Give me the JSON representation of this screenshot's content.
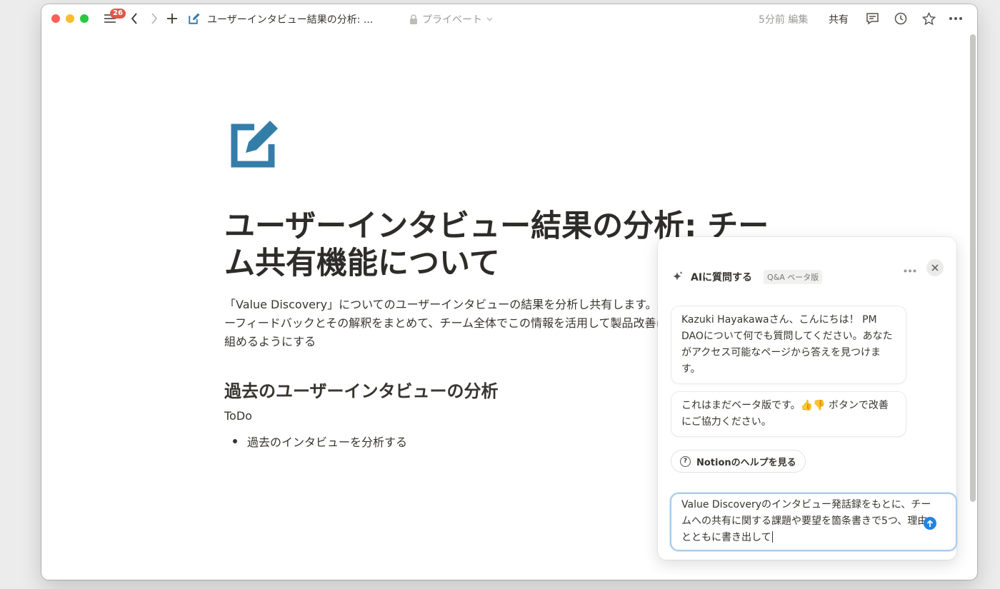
{
  "titlebar": {
    "badge_count": "26",
    "page_title": "ユーザーインタビュー結果の分析: ...",
    "privacy_label": "プライベート",
    "edited_label": "5分前 編集",
    "share_label": "共有"
  },
  "page": {
    "title": "ユーザーインタビュー結果の分析: チーム共有機能について",
    "description": "「Value Discovery」についてのユーザーインタビューの結果を分析し共有します。ユーザーフィードバックとその解釈をまとめて、チーム全体でこの情報を活用して製品改善に取り組めるようにする",
    "heading": "過去のユーザーインタビューの分析",
    "todo_label": "ToDo",
    "bullets": [
      "過去のインタビューを分析する"
    ]
  },
  "ai_panel": {
    "title": "AIに質問する",
    "tag": "Q&A ベータ版",
    "messages": [
      "Kazuki Hayakawaさん、こんにちは！ PM DAOについて何でも質問してください。あなたがアクセス可能なページから答えを見つけます。",
      "これはまだベータ版です。👍👎 ボタンで改善にご協力ください。"
    ],
    "help_button": "Notionのヘルプを見る",
    "input_value": "Value Discoveryのインタビュー発話録をもとに、チームへの共有に関する課題や要望を箇条書きで5つ、理由とともに書き出して"
  },
  "colors": {
    "accent": "#2383e2",
    "page_icon": "#337ea9",
    "badge": "#e0564a"
  }
}
